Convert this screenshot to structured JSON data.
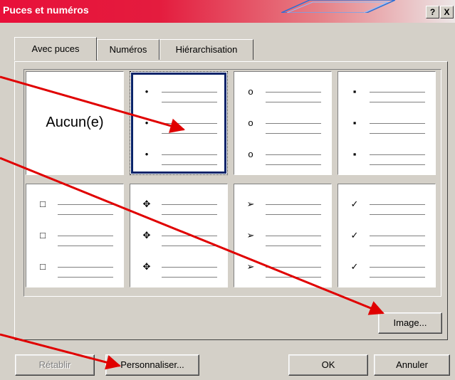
{
  "window": {
    "title": "Puces et numéros",
    "help_label": "?",
    "close_label": "X"
  },
  "tabs": [
    {
      "label": "Avec puces",
      "active": true
    },
    {
      "label": "Numéros",
      "active": false
    },
    {
      "label": "Hiérarchisation",
      "active": false
    }
  ],
  "bullet_styles": [
    {
      "type": "none",
      "label": "Aucun(e)"
    },
    {
      "type": "bullet",
      "glyph": "•",
      "icon": "filled-circle-bullet-icon",
      "selected": true
    },
    {
      "type": "bullet",
      "glyph": "o",
      "icon": "hollow-circle-bullet-icon"
    },
    {
      "type": "bullet",
      "glyph": "▪",
      "icon": "square-bullet-icon"
    },
    {
      "type": "bullet",
      "glyph": "□",
      "icon": "hollow-square-bullet-icon"
    },
    {
      "type": "bullet",
      "glyph": "✥",
      "icon": "four-diamond-bullet-icon"
    },
    {
      "type": "bullet",
      "glyph": "➢",
      "icon": "arrowhead-bullet-icon"
    },
    {
      "type": "bullet",
      "glyph": "✓",
      "icon": "checkmark-bullet-icon"
    }
  ],
  "buttons": {
    "image": "Image...",
    "reset": "Rétablir",
    "customize": "Personnaliser...",
    "ok": "OK",
    "cancel": "Annuler"
  },
  "colors": {
    "arrow": "#e00000",
    "selection": "#0a246a",
    "titlebar": "#e8103a"
  }
}
